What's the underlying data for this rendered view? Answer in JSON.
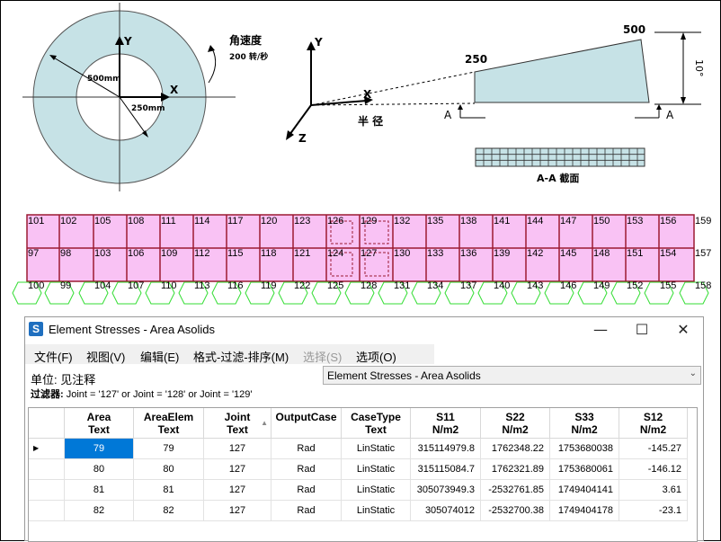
{
  "diagram": {
    "ring": {
      "label_500": "500mm",
      "label_250": "250mm",
      "x_axis": "X",
      "y_axis": "Y",
      "angular_velocity": "角速度",
      "speed": "200 转/秒"
    },
    "wedge": {
      "label_500": "500",
      "label_250": "250",
      "x_axis": "X",
      "y_axis": "Y",
      "z_axis": "Z",
      "radius": "半 径",
      "angle": "10°",
      "section_mark_a1": "A",
      "section_mark_a2": "A",
      "section_title": "A-A 截面"
    }
  },
  "mesh": {
    "top_row": [
      "101",
      "102",
      "105",
      "108",
      "111",
      "114",
      "117",
      "120",
      "123",
      "126",
      "129",
      "132",
      "135",
      "138",
      "141",
      "144",
      "147",
      "150",
      "153",
      "156",
      "159"
    ],
    "mid_row": [
      "97",
      "98",
      "103",
      "106",
      "109",
      "112",
      "115",
      "118",
      "121",
      "124",
      "127",
      "130",
      "133",
      "136",
      "139",
      "142",
      "145",
      "148",
      "151",
      "154",
      "157"
    ],
    "bottom_row": [
      "100",
      "99",
      "104",
      "107",
      "110",
      "113",
      "116",
      "119",
      "122",
      "125",
      "128",
      "131",
      "134",
      "137",
      "140",
      "143",
      "146",
      "149",
      "152",
      "155",
      "158"
    ]
  },
  "window": {
    "title": "Element Stresses - Area Asolids",
    "icon_letter": "S",
    "minimize": "—",
    "maximize": "☐",
    "close": "✕",
    "menu": [
      {
        "label": "文件(F)",
        "disabled": false
      },
      {
        "label": "视图(V)",
        "disabled": false
      },
      {
        "label": "编辑(E)",
        "disabled": false
      },
      {
        "label": "格式-过滤-排序(M)",
        "disabled": false
      },
      {
        "label": "选择(S)",
        "disabled": true
      },
      {
        "label": "选项(O)",
        "disabled": false
      }
    ],
    "units_label": "单位: 见注释",
    "filter_label": "过滤器:",
    "filter_value": "Joint = '127' or Joint = '128' or Joint = '129'",
    "combo_value": "Element Stresses - Area Asolids",
    "columns": [
      {
        "l1": "Area",
        "l2": "Text"
      },
      {
        "l1": "AreaElem",
        "l2": "Text"
      },
      {
        "l1": "Joint",
        "l2": "Text"
      },
      {
        "l1": "OutputCase",
        "l2": ""
      },
      {
        "l1": "CaseType",
        "l2": "Text"
      },
      {
        "l1": "S11",
        "l2": "N/m2"
      },
      {
        "l1": "S22",
        "l2": "N/m2"
      },
      {
        "l1": "S33",
        "l2": "N/m2"
      },
      {
        "l1": "S12",
        "l2": "N/m2"
      }
    ],
    "rows": [
      [
        "79",
        "79",
        "127",
        "Rad",
        "LinStatic",
        "315114979.8",
        "1762348.22",
        "1753680038",
        "-145.27"
      ],
      [
        "80",
        "80",
        "127",
        "Rad",
        "LinStatic",
        "315115084.7",
        "1762321.89",
        "1753680061",
        "-146.12"
      ],
      [
        "81",
        "81",
        "127",
        "Rad",
        "LinStatic",
        "305073949.3",
        "-2532761.85",
        "1749404141",
        "3.61"
      ],
      [
        "82",
        "82",
        "127",
        "Rad",
        "LinStatic",
        "305074012",
        "-2532700.38",
        "1749404178",
        "-23.1"
      ]
    ]
  }
}
